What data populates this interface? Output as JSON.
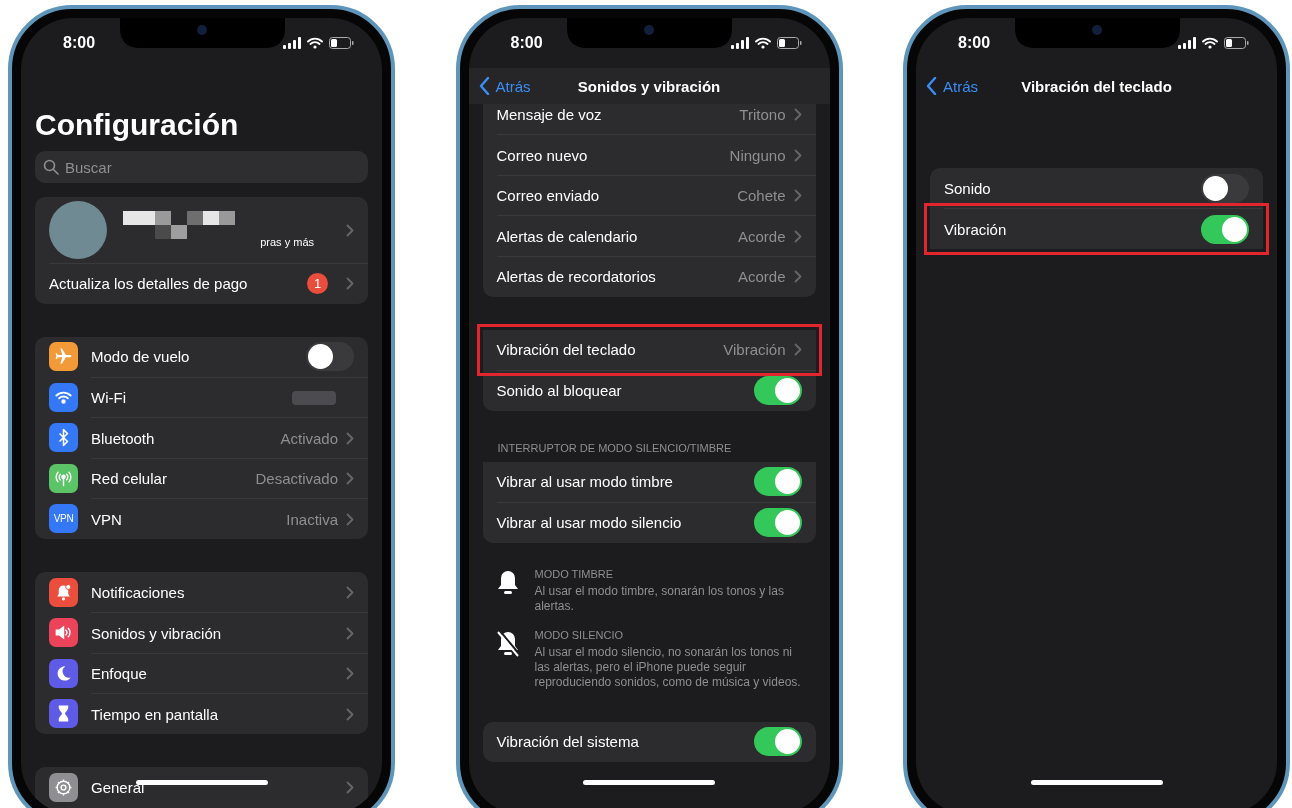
{
  "phones": [
    {
      "time": "8:00",
      "title": "Configuración",
      "search": {
        "placeholder": "Buscar"
      },
      "sections": [
        {
          "kind": "group",
          "rows": [
            {
              "kind": "profile",
              "subtitle": "pras y más"
            },
            {
              "kind": "link",
              "label": "Actualiza los detalles de pago",
              "badge": "1"
            }
          ]
        },
        {
          "kind": "group",
          "rows": [
            {
              "kind": "airplane",
              "color": "#f19a37",
              "label": "Modo de vuelo",
              "on": false
            },
            {
              "kind": "wifi",
              "color": "#3478f6",
              "label": "Wi-Fi"
            },
            {
              "kind": "bluetooth",
              "color": "#3478f6",
              "label": "Bluetooth",
              "value": "Activado"
            },
            {
              "kind": "antenna",
              "color": "#5bc466",
              "label": "Red celular",
              "value": "Desactivado"
            },
            {
              "kind": "vpn",
              "color": "#3478f6",
              "icon_text": "VPN",
              "label": "VPN",
              "value": "Inactiva"
            }
          ]
        },
        {
          "kind": "group",
          "rows": [
            {
              "kind": "bell",
              "color": "#eb4e3d",
              "label": "Notificaciones"
            },
            {
              "kind": "speaker",
              "color": "#eb445a",
              "label": "Sonidos y vibración"
            },
            {
              "kind": "moon",
              "color": "#5e5ce6",
              "label": "Enfoque"
            },
            {
              "kind": "hourglass",
              "color": "#5e5ce6",
              "label": "Tiempo en pantalla"
            }
          ]
        },
        {
          "kind": "group",
          "rows": [
            {
              "kind": "gear",
              "color": "#8e8e93",
              "label": "General"
            }
          ]
        }
      ]
    },
    {
      "time": "8:00",
      "nav": {
        "back": "Atrás",
        "title": "Sonidos y vibración"
      },
      "sections": [
        {
          "kind": "group",
          "rows": [
            {
              "kind": "link",
              "label": "Mensaje de voz",
              "value": "Tritono",
              "highlighted": false
            },
            {
              "kind": "link",
              "label": "Correo nuevo",
              "value": "Ninguno",
              "highlighted": false
            },
            {
              "kind": "link",
              "label": "Correo enviado",
              "value": "Cohete",
              "highlighted": false
            },
            {
              "kind": "link",
              "label": "Alertas de calendario",
              "value": "Acorde",
              "highlighted": false
            },
            {
              "kind": "link",
              "label": "Alertas de recordatorios",
              "value": "Acorde",
              "highlighted": false
            }
          ]
        },
        {
          "kind": "group",
          "rows": [
            {
              "kind": "link",
              "label": "Vibración del teclado",
              "value": "Vibración",
              "highlighted": true
            },
            {
              "kind": "toggle",
              "label": "Sonido al bloquear",
              "on": true,
              "highlighted": false
            }
          ]
        },
        {
          "kind": "group",
          "header": "INTERRUPTOR DE MODO SILENCIO/TIMBRE",
          "rows": [
            {
              "kind": "toggle",
              "label": "Vibrar al usar modo timbre",
              "on": true,
              "highlighted": false
            },
            {
              "kind": "toggle",
              "label": "Vibrar al usar modo silencio",
              "on": true,
              "highlighted": false
            }
          ]
        },
        {
          "kind": "notes",
          "items": [
            {
              "kind": "bell",
              "title": "MODO TIMBRE",
              "text": "Al usar el modo timbre, sonarán los tonos y las alertas."
            },
            {
              "kind": "bell-slash",
              "title": "MODO SILENCIO",
              "text": "Al usar el modo silencio, no sonarán los tonos ni las alertas, pero el iPhone puede seguir reproduciendo sonidos, como de música y videos."
            }
          ]
        },
        {
          "kind": "group",
          "rows": [
            {
              "kind": "toggle",
              "label": "Vibración del sistema",
              "on": true,
              "highlighted": false
            }
          ]
        }
      ]
    },
    {
      "time": "8:00",
      "nav": {
        "back": "Atrás",
        "title": "Vibración del teclado"
      },
      "sections": [
        {
          "kind": "group",
          "rows": [
            {
              "kind": "toggle",
              "label": "Sonido",
              "on": false,
              "highlighted": false
            },
            {
              "kind": "toggle",
              "label": "Vibración",
              "on": true,
              "highlighted": true
            }
          ]
        }
      ]
    }
  ]
}
